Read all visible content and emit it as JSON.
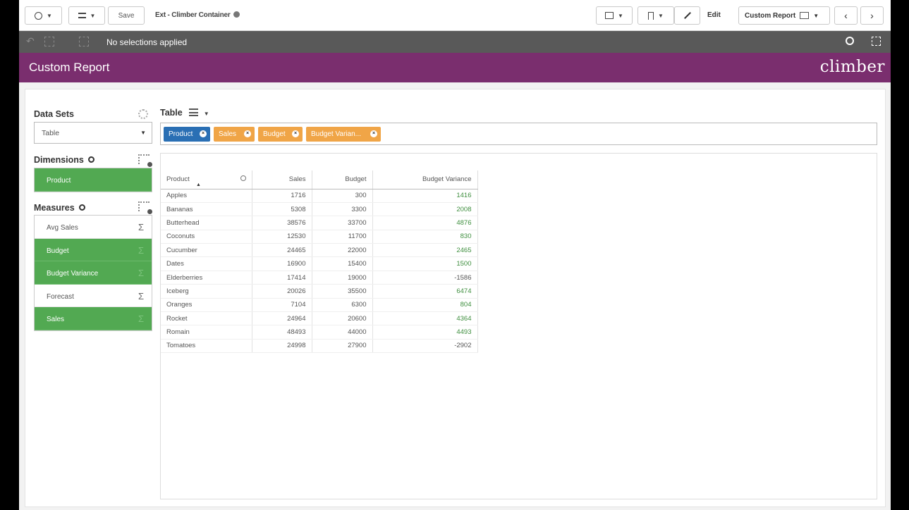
{
  "toolbar": {
    "save_label": "Save",
    "app_title": "Ext - Climber Container",
    "edit_label": "Edit",
    "sheet_name": "Custom Report"
  },
  "selection_bar": {
    "text": "No selections applied"
  },
  "header": {
    "title": "Custom Report",
    "logo": "climber"
  },
  "sidebar": {
    "data_sets_heading": "Data Sets",
    "data_set_value": "Table",
    "dimensions_heading": "Dimensions",
    "dimensions": [
      {
        "label": "Product",
        "selected": true
      }
    ],
    "measures_heading": "Measures",
    "measures": [
      {
        "label": "Avg Sales",
        "selected": false
      },
      {
        "label": "Budget",
        "selected": true
      },
      {
        "label": "Budget Variance",
        "selected": true
      },
      {
        "label": "Forecast",
        "selected": false
      },
      {
        "label": "Sales",
        "selected": true
      }
    ],
    "sigma_glyph": "Σ"
  },
  "chart": {
    "heading": "Table",
    "pills": [
      {
        "label": "Product",
        "color": "#2a6fb4"
      },
      {
        "label": "Sales",
        "color": "#f0a547"
      },
      {
        "label": "Budget",
        "color": "#f0a547"
      },
      {
        "label": "Budget Varian...",
        "color": "#f0a547"
      }
    ]
  },
  "table": {
    "headers": [
      "Product",
      "Sales",
      "Budget",
      "Budget Variance"
    ],
    "rows": [
      [
        "Apples",
        "1716",
        "300",
        "1416"
      ],
      [
        "Bananas",
        "5308",
        "3300",
        "2008"
      ],
      [
        "Butterhead",
        "38576",
        "33700",
        "4876"
      ],
      [
        "Coconuts",
        "12530",
        "11700",
        "830"
      ],
      [
        "Cucumber",
        "24465",
        "22000",
        "2465"
      ],
      [
        "Dates",
        "16900",
        "15400",
        "1500"
      ],
      [
        "Elderberries",
        "17414",
        "19000",
        "-1586"
      ],
      [
        "Iceberg",
        "20026",
        "35500",
        "6474"
      ],
      [
        "Oranges",
        "7104",
        "6300",
        "804"
      ],
      [
        "Rocket",
        "24964",
        "20600",
        "4364"
      ],
      [
        "Romain",
        "48493",
        "44000",
        "4493"
      ],
      [
        "Tomatoes",
        "24998",
        "27900",
        "-2902"
      ]
    ]
  },
  "colors": {
    "header_band": "#7a2e6e",
    "selected_field": "#52a952",
    "dimension_pill": "#2a6fb4",
    "measure_pill": "#f0a547",
    "positive_variance": "#3e8e3e"
  }
}
